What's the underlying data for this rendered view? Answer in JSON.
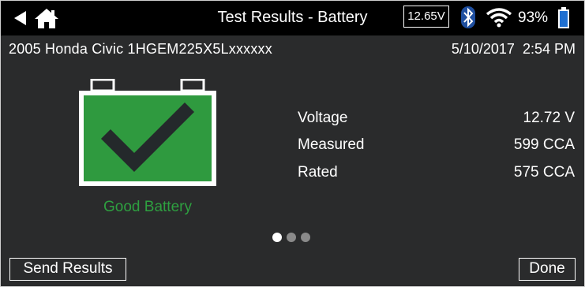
{
  "header": {
    "title": "Test Results - Battery",
    "system_voltage": "12.65V",
    "battery_percent": "93%",
    "icons": {
      "back": "back-arrow-icon",
      "home": "home-icon",
      "bluetooth": "bluetooth-icon",
      "wifi": "wifi-icon",
      "battery": "battery-icon"
    }
  },
  "vehicle": {
    "description": "2005 Honda Civic 1HGEM225X5Lxxxxxx",
    "date": "5/10/2017",
    "time": "2:54 PM"
  },
  "result": {
    "status": "Good Battery",
    "status_color": "#2ea040",
    "battery_fill_color": "#2f9a3f",
    "check_color": "#24292b"
  },
  "metrics": [
    {
      "label": "Voltage",
      "value": "12.72 V"
    },
    {
      "label": "Measured",
      "value": "599 CCA"
    },
    {
      "label": "Rated",
      "value": "575 CCA"
    }
  ],
  "pager": {
    "total": 3,
    "active": 1
  },
  "footer": {
    "send_label": "Send Results",
    "done_label": "Done"
  }
}
